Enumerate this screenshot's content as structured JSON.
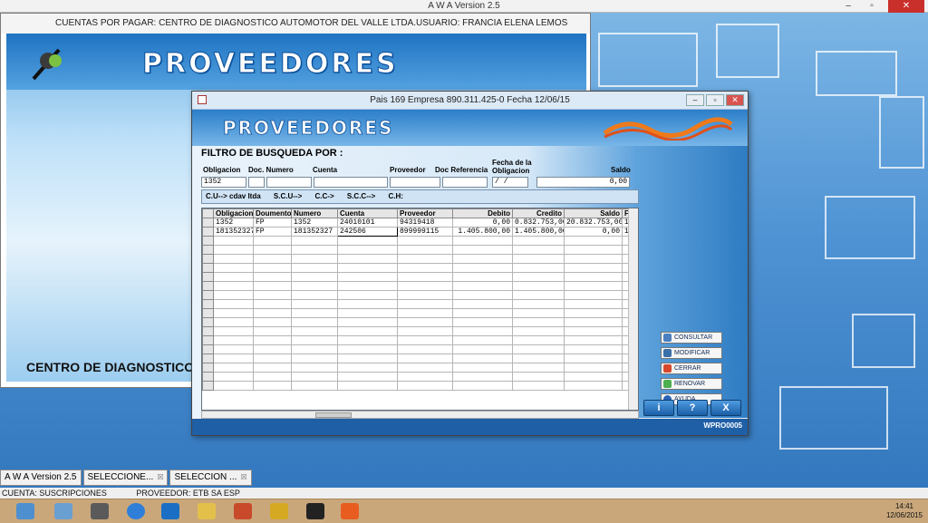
{
  "app": {
    "title": "A W A Version 2.5",
    "min": "–",
    "max": "▫",
    "close": "✕"
  },
  "back_window": {
    "header": "CUENTAS POR PAGAR: CENTRO DE DIAGNOSTICO AUTOMOTOR DEL VALLE LTDA.USUARIO: FRANCIA ELENA LEMOS MUÑOZ",
    "banner_title": "PROVEEDORES",
    "centro": "CENTRO DE DIAGNOSTICO"
  },
  "dialog": {
    "title": "Pais 169 Empresa 890.311.425-0 Fecha 12/06/15",
    "min": "–",
    "max": "▫",
    "close": "✕",
    "banner_title": "PROVEEDORES",
    "filtro_label": "FILTRO DE BUSQUEDA POR :",
    "filters": {
      "obligacion_label": "Obligacion",
      "doc_numero_label": "Doc. Numero",
      "cuenta_label": "Cuenta",
      "proveedor_label": "Proveedor",
      "doc_referencia_label": "Doc Referencia",
      "fecha_label_1": "Fecha de la",
      "fecha_label_2": "Obligacion",
      "saldo_label": "Saldo",
      "obligacion_value": "1352",
      "fecha_value": " /  /",
      "saldo_value": "0,00"
    },
    "cu_bar": [
      "C.U--> cdav ltda",
      "S.C.U-->",
      "C.C->",
      "S.C.C-->",
      "C.H:"
    ],
    "grid": {
      "columns": [
        "Obligacion",
        "Doumento",
        "Numero",
        "Cuenta",
        "Proveedor",
        "Debito",
        "Credito",
        "Saldo",
        "F"
      ],
      "rows": [
        [
          "1352",
          "FP",
          "1352",
          "24010101",
          "94319418",
          "0,00",
          "0.832.753,00",
          "20.832.753,00",
          "1"
        ],
        [
          "181352327",
          "FP",
          "181352327",
          "242506",
          "899999115",
          "1.405.800,00",
          "1.405.800,00",
          "0,00",
          "1"
        ]
      ]
    },
    "side_buttons": [
      "CONSULTAR",
      "MODIFICAR",
      "CERRAR",
      "RENOVAR",
      "AYUDA"
    ],
    "bottom_buttons": [
      "i",
      "?",
      "X"
    ],
    "footer_code": "WPRO0005"
  },
  "tabs": [
    {
      "label": "A W A Version 2.5"
    },
    {
      "label": "SELECCIONE...",
      "close": "☒"
    },
    {
      "label": "SELECCION ...",
      "close": "☒"
    }
  ],
  "status": {
    "cuenta": "CUENTA: SUSCRIPCIONES",
    "proveedor": "PROVEEDOR: ETB SA ESP"
  },
  "clock": {
    "time": "14:41",
    "date": "12/06/2015"
  }
}
